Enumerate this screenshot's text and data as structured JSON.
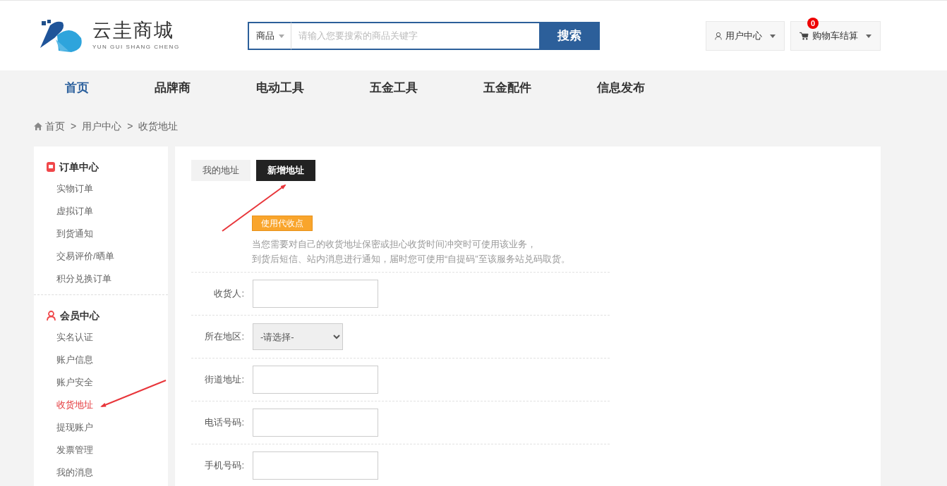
{
  "header": {
    "logo": {
      "title": "云圭商城",
      "subtitle": "YUN GUI SHANG CHENG"
    },
    "search": {
      "category": "商品",
      "placeholder": "请输入您要搜索的商品关键字",
      "button": "搜索"
    },
    "user_menu": {
      "label": "用户中心"
    },
    "cart": {
      "label": "购物车结算",
      "count": "0"
    }
  },
  "nav": [
    {
      "label": "首页",
      "selected": true
    },
    {
      "label": "品牌商",
      "selected": false
    },
    {
      "label": "电动工具",
      "selected": false
    },
    {
      "label": "五金工具",
      "selected": false
    },
    {
      "label": "五金配件",
      "selected": false
    },
    {
      "label": "信息发布",
      "selected": false
    }
  ],
  "breadcrumb": {
    "separator": ">",
    "items": [
      "首页",
      "用户中心",
      "收货地址"
    ]
  },
  "sidebar": {
    "sections": [
      {
        "kind": "order",
        "title": "订单中心",
        "items": [
          {
            "label": "实物订单",
            "selected": false
          },
          {
            "label": "虚拟订单",
            "selected": false
          },
          {
            "label": "到货通知",
            "selected": false
          },
          {
            "label": "交易评价/晒单",
            "selected": false
          },
          {
            "label": "积分兑换订单",
            "selected": false
          }
        ]
      },
      {
        "kind": "member",
        "title": "会员中心",
        "items": [
          {
            "label": "实名认证",
            "selected": false
          },
          {
            "label": "账户信息",
            "selected": false
          },
          {
            "label": "账户安全",
            "selected": false
          },
          {
            "label": "收货地址",
            "selected": true
          },
          {
            "label": "提现账户",
            "selected": false
          },
          {
            "label": "发票管理",
            "selected": false
          },
          {
            "label": "我的消息",
            "selected": false
          }
        ]
      }
    ]
  },
  "tabs": [
    {
      "label": "我的地址",
      "selected": false
    },
    {
      "label": "新增地址",
      "selected": true
    }
  ],
  "pickup": {
    "button": "使用代收点",
    "notes": [
      "当您需要对自己的收货地址保密或担心收货时间冲突时可使用该业务，",
      "到货后短信、站内消息进行通知，届时您可使用“自提码”至该服务站兑码取货。"
    ]
  },
  "form": {
    "fields": [
      {
        "kind": "text",
        "label": "收货人:"
      },
      {
        "kind": "select",
        "label": "所在地区:",
        "value": "-请选择-"
      },
      {
        "kind": "text",
        "label": "街道地址:"
      },
      {
        "kind": "text",
        "label": "电话号码:"
      },
      {
        "kind": "text",
        "label": "手机号码:"
      }
    ]
  }
}
